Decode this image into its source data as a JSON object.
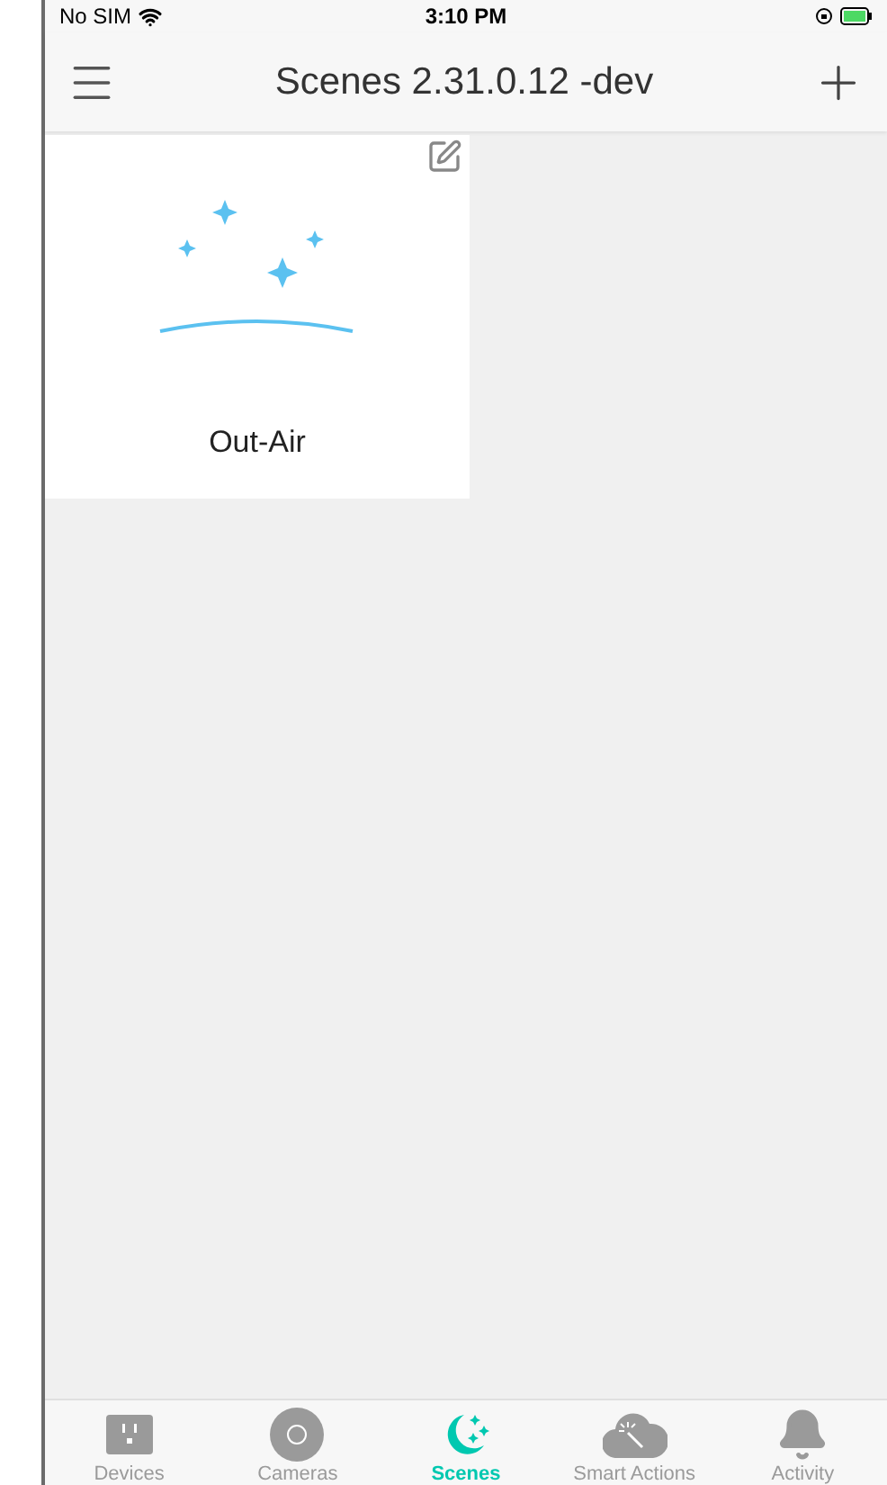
{
  "status_bar": {
    "carrier": "No SIM",
    "time": "3:10 PM"
  },
  "nav_bar": {
    "title": "Scenes 2.31.0.12 -dev"
  },
  "scenes": [
    {
      "name": "Out-Air"
    }
  ],
  "tab_bar": [
    {
      "label": "Devices",
      "kind": "devices",
      "selected": false
    },
    {
      "label": "Cameras",
      "kind": "cameras",
      "selected": false
    },
    {
      "label": "Scenes",
      "kind": "scenes",
      "selected": true
    },
    {
      "label": "Smart Actions",
      "kind": "actions",
      "selected": false
    },
    {
      "label": "Activity",
      "kind": "activity",
      "selected": false
    }
  ]
}
